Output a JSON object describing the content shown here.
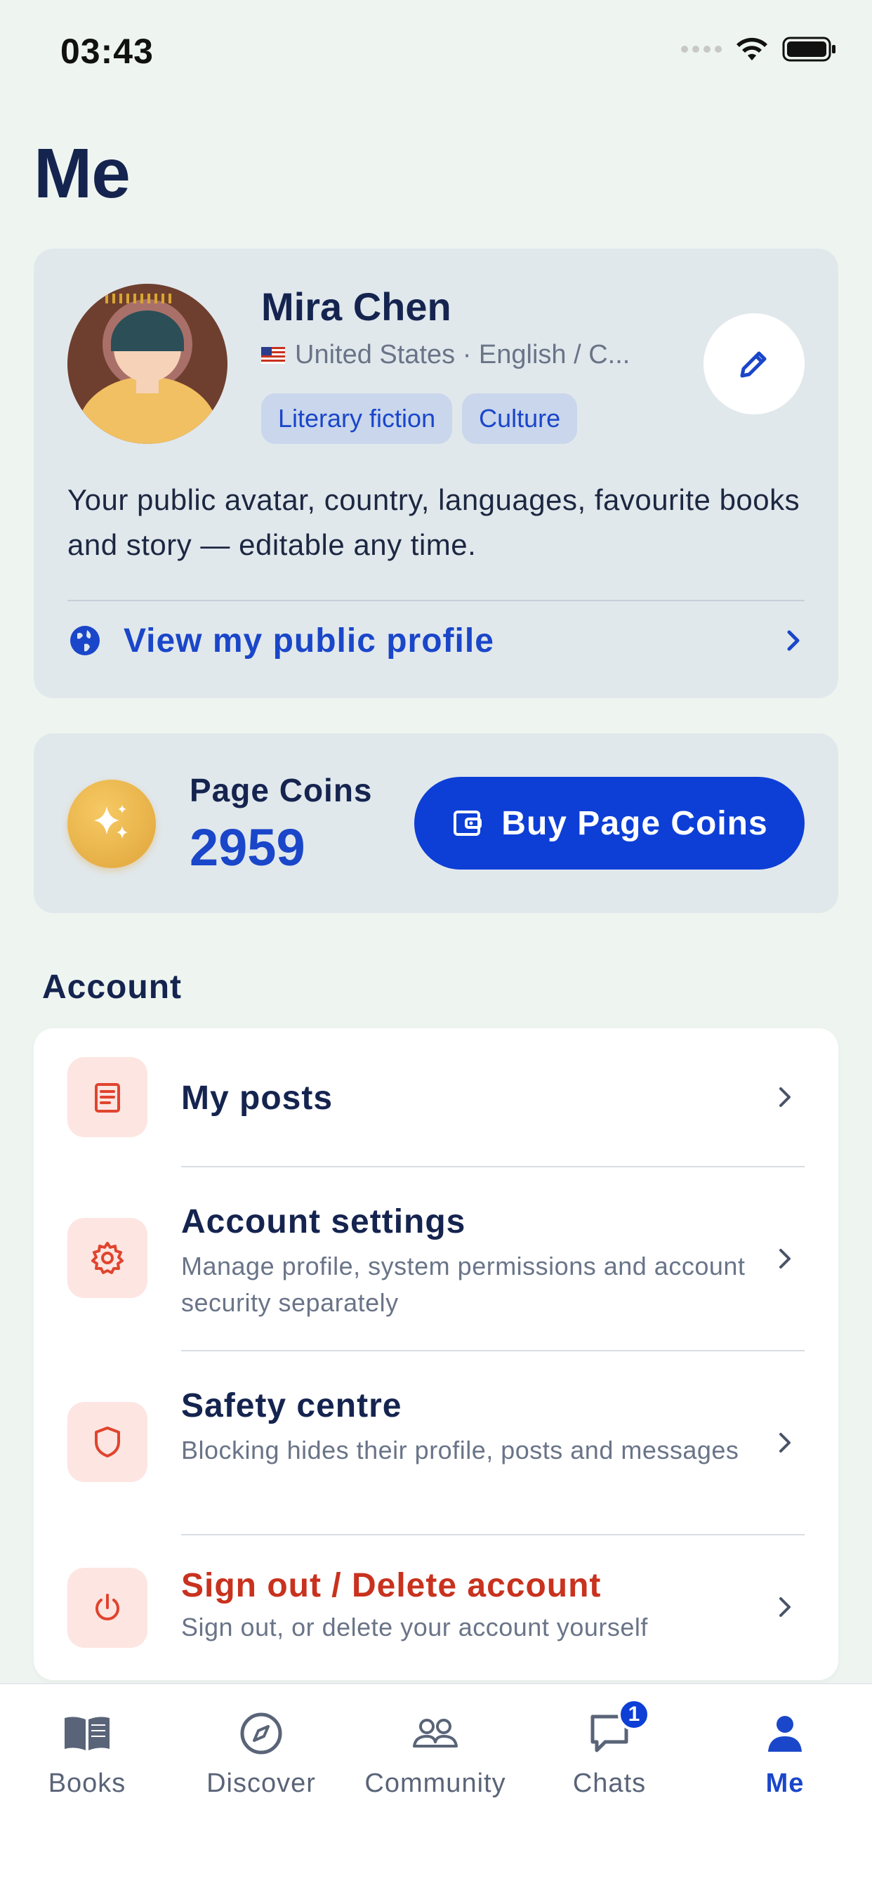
{
  "status_bar": {
    "time": "03:43",
    "icons": [
      "signal-icon",
      "wifi-icon",
      "battery-icon"
    ]
  },
  "page_title": "Me",
  "profile": {
    "name": "Mira Chen",
    "flag": "🇺🇸",
    "meta": "United States · English / C...",
    "tags": [
      "Literary fiction",
      "Culture"
    ],
    "description": "Your public avatar, country, languages, favourite books and story — editable any time.",
    "public_link_label": "View my public profile"
  },
  "coins": {
    "label": "Page Coins",
    "value": "2959",
    "buy_label": "Buy Page Coins"
  },
  "account": {
    "section_title": "Account",
    "items": [
      {
        "title": "My posts",
        "subtitle": "",
        "icon": "document-icon"
      },
      {
        "title": "Account settings",
        "subtitle": "Manage profile, system permissions and account security separately",
        "icon": "gear-icon"
      },
      {
        "title": "Safety centre",
        "subtitle": "Blocking hides their profile, posts and messages",
        "icon": "shield-icon"
      },
      {
        "title": "Sign out / Delete account",
        "subtitle": "Sign out, or delete your account yourself",
        "icon": "power-icon"
      }
    ]
  },
  "tab_bar": {
    "tabs": [
      {
        "label": "Books",
        "icon": "book-icon"
      },
      {
        "label": "Discover",
        "icon": "compass-icon"
      },
      {
        "label": "Community",
        "icon": "people-icon"
      },
      {
        "label": "Chats",
        "icon": "chat-icon",
        "badge": "1"
      },
      {
        "label": "Me",
        "icon": "person-icon",
        "active": true
      }
    ]
  },
  "colors": {
    "accent": "#1a46c9",
    "button": "#0d3fd6",
    "danger": "#c8321e",
    "background": "#eef5f0",
    "card": "#e1e8ec"
  }
}
